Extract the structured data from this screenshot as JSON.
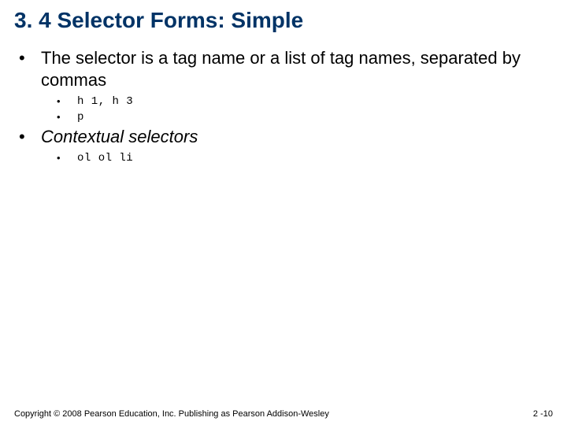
{
  "title": "3. 4 Selector Forms: Simple",
  "bullets": {
    "b1": "The selector is a tag name or a list of tag names, separated by commas",
    "b1a": "h 1, h 3",
    "b1b": "p",
    "b2": "Contextual selectors",
    "b2a": "ol ol li"
  },
  "footer": {
    "left": "Copyright © 2008 Pearson Education, Inc. Publishing as Pearson Addison-Wesley",
    "right": "2 -10"
  }
}
